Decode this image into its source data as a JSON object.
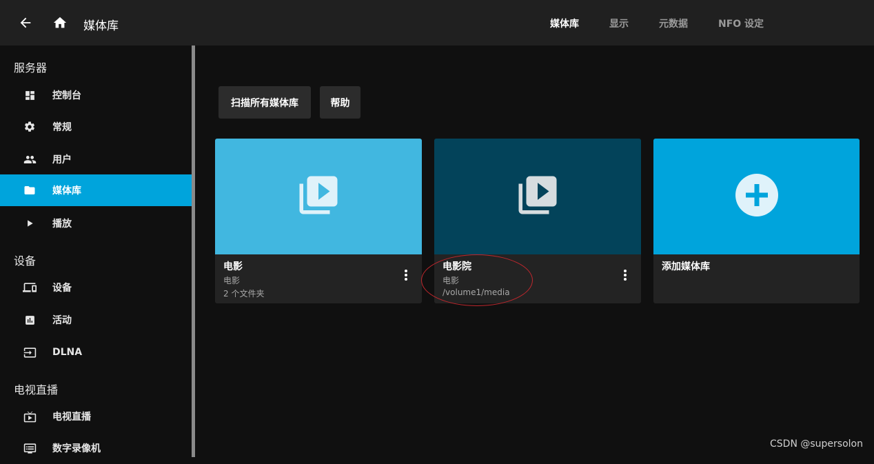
{
  "header": {
    "title": "媒体库",
    "tabs": [
      {
        "label": "媒体库",
        "active": true
      },
      {
        "label": "显示",
        "active": false
      },
      {
        "label": "元数据",
        "active": false
      },
      {
        "label": "NFO 设定",
        "active": false
      }
    ]
  },
  "sidebar": {
    "sections": [
      {
        "title": "服务器"
      },
      {
        "title": "设备"
      },
      {
        "title": "电视直播"
      }
    ],
    "items": [
      {
        "label": "控制台",
        "icon": "dashboard-icon"
      },
      {
        "label": "常规",
        "icon": "gear-icon"
      },
      {
        "label": "用户",
        "icon": "users-icon"
      },
      {
        "label": "媒体库",
        "icon": "folder-icon",
        "active": true
      },
      {
        "label": "播放",
        "icon": "play-icon"
      },
      {
        "label": "设备",
        "icon": "devices-icon"
      },
      {
        "label": "活动",
        "icon": "activity-icon"
      },
      {
        "label": "DLNA",
        "icon": "input-icon"
      },
      {
        "label": "电视直播",
        "icon": "live-tv-icon"
      },
      {
        "label": "数字录像机",
        "icon": "dvr-icon"
      }
    ]
  },
  "toolbar": {
    "scan_label": "扫描所有媒体库",
    "help_label": "帮助"
  },
  "libraries": [
    {
      "title": "电影",
      "line1": "电影",
      "line2": "2 个文件夹",
      "color": "#41b7e0",
      "icon": "video-library-icon"
    },
    {
      "title": "电影院",
      "line1": "电影",
      "line2": "/volume1/media",
      "color": "#03435a",
      "icon": "video-library-icon"
    },
    {
      "title": "添加媒体库",
      "color": "#00a4dc",
      "icon": "add-circle-icon"
    }
  ],
  "watermark": "CSDN @supersolon",
  "colors": {
    "accent": "#00a4dc",
    "annotation": "#c0272d"
  }
}
